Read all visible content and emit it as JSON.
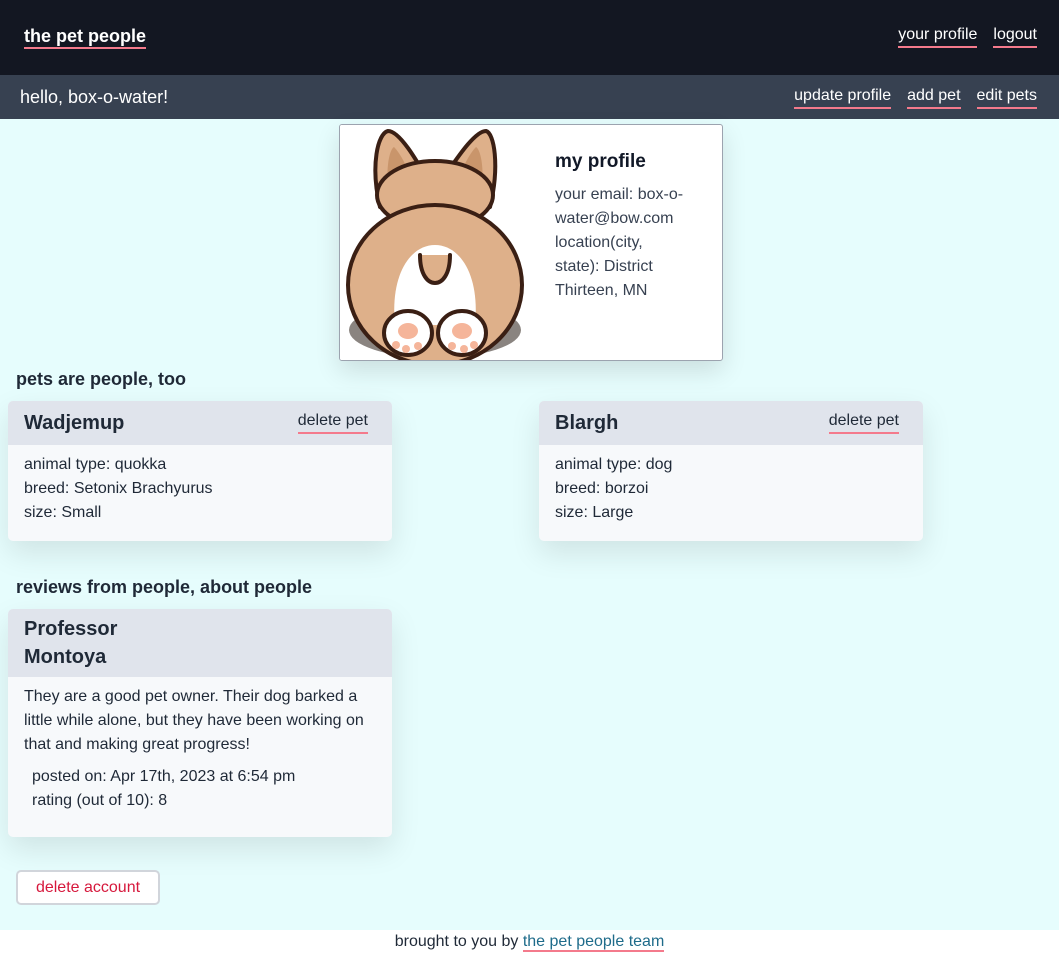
{
  "nav": {
    "brand": "the pet people",
    "links": [
      "your profile",
      "logout"
    ]
  },
  "subnav": {
    "greeting": "hello, box-o-water!",
    "links": [
      "update profile",
      "add pet",
      "edit pets"
    ]
  },
  "profile": {
    "title": "my profile",
    "email_line_1": "your email: box-o-",
    "email_line_2": "water@bow.com",
    "location_line_1": "location(city,",
    "location_line_2": "state): District",
    "location_line_3": "Thirteen, MN",
    "image_icon": "corgi-butt-icon"
  },
  "pets": {
    "heading": "pets are people, too",
    "delete_label": "delete pet",
    "items": [
      {
        "name": "Wadjemup",
        "animal_type": "animal type: quokka",
        "breed": "breed: Setonix Brachyurus",
        "size": "size: Small"
      },
      {
        "name": "Blargh",
        "animal_type": "animal type: dog",
        "breed": "breed: borzoi",
        "size": "size: Large"
      }
    ]
  },
  "reviews": {
    "heading": "reviews from people, about people",
    "items": [
      {
        "author": "Professor Montoya",
        "text": "They are a good pet owner. Their dog barked a little while alone, but they have been working on that and making great progress!",
        "posted": "posted on: Apr 17th, 2023 at 6:54 pm",
        "rating": "rating (out of 10): 8"
      }
    ]
  },
  "account": {
    "delete_label": "delete account"
  },
  "footer": {
    "prefix": "brought to you by",
    "link": "the pet people team"
  },
  "colors": {
    "nav_bg": "#131722",
    "subnav_bg": "#374151",
    "main_bg": "#e6fdfd",
    "underline": "#f47a8c",
    "danger": "#d6183c"
  }
}
